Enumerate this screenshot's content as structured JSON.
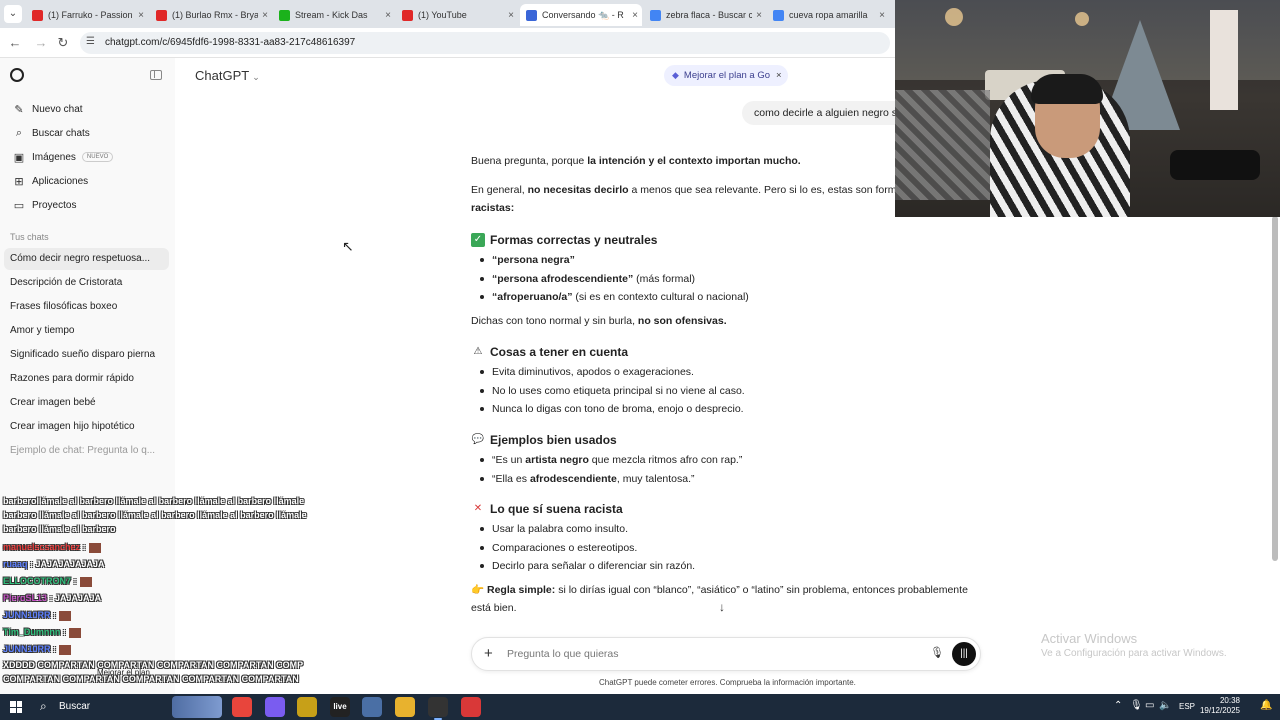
{
  "browser": {
    "tabs": [
      {
        "title": "(1) Farruko - Passion",
        "favicon": "youtube-icon",
        "color": "#e02828"
      },
      {
        "title": "(1) Burlao Rmx - Brya",
        "favicon": "youtube-icon",
        "color": "#e02828"
      },
      {
        "title": "Stream - Kick Das",
        "favicon": "kick-icon",
        "color": "#1bb21b"
      },
      {
        "title": "(1) YouTube",
        "favicon": "youtube-icon",
        "color": "#e02828"
      },
      {
        "title": "Conversando 🐀 - R",
        "favicon": "chatgpt-icon",
        "color": "#3a66d8"
      },
      {
        "title": "zebra flaca - Buscar c",
        "favicon": "google-icon",
        "color": "#4285f4"
      },
      {
        "title": "cueva ropa amarilla",
        "favicon": "google-icon",
        "color": "#4285f4"
      }
    ],
    "url": "chatgpt.com/c/6945fdf6-1998-8331-aa83-217c48616397"
  },
  "sidebar": {
    "nav": [
      {
        "label": "Nuevo chat",
        "icon": "new-chat-icon",
        "glyph": "✎"
      },
      {
        "label": "Buscar chats",
        "icon": "search-icon",
        "glyph": "⌕"
      },
      {
        "label": "Imágenes",
        "icon": "images-icon",
        "glyph": "▣",
        "badge": "NUEVO"
      },
      {
        "label": "Aplicaciones",
        "icon": "apps-icon",
        "glyph": "⊞"
      },
      {
        "label": "Proyectos",
        "icon": "folder-icon",
        "glyph": "▭"
      }
    ],
    "section_label": "Tus chats",
    "chats": [
      "Cómo decir negro respetuosa...",
      "Descripción de Cristorata",
      "Frases filosóficas boxeo",
      "Amor y tiempo",
      "Significado sueño disparo pierna",
      "Razones para dormir rápido",
      "Crear imagen bebé",
      "Crear imagen hijo hipotético",
      "Ejemplo de chat: Pregunta lo q..."
    ],
    "upsell": "Mejorar el plan"
  },
  "stream_chat": {
    "lines": [
      {
        "user": "",
        "text": "barberoIlámale al barbero llámale al barbero llámale al barbero llámale",
        "color": "#ffffff"
      },
      {
        "user": "",
        "text": "barbero llámale al barbero llámale al barbero llámale al barbero llámale",
        "color": "#ffffff"
      },
      {
        "user": "",
        "text": "barbero llámale al barbero",
        "color": "#ffffff"
      },
      {
        "user": "manuelscsanchez",
        "text": ":",
        "color": "#e83a3a"
      },
      {
        "user": "ruaaq",
        "text": ": JAJAJAJAJAJA",
        "color": "#5b7fff"
      },
      {
        "user": "ELLOCOTRON7",
        "text": ":",
        "color": "#2fc07c"
      },
      {
        "user": "PieroSL13",
        "text": ": JAJAJAJA",
        "color": "#c04ec0"
      },
      {
        "user": "JUNN10RR",
        "text": ":",
        "color": "#5b7fff"
      },
      {
        "user": "Tim_Dumnnn",
        "text": ":",
        "color": "#2fc07c"
      },
      {
        "user": "JUNN10RR",
        "text": ":",
        "color": "#5b7fff"
      },
      {
        "user": "XDDDD",
        "text": "COMPARTAN COMPARTAN COMPARTAN COMPARTAN COMP",
        "color": "#ffffff"
      },
      {
        "user": "",
        "text": "COMPARTAN COMPARTAN COMPARTAN COMPARTAN COMPARTAN",
        "color": "#ffffff"
      }
    ]
  },
  "main": {
    "model_label": "ChatGPT",
    "upgrade_label": "Mejorar el plan a Go",
    "user_message": "como decirle a alguien negro s",
    "answer": {
      "intro_prefix": "Buena pregunta, porque ",
      "intro_bold": "la intención y el contexto importan mucho.",
      "general_prefix": "En general, ",
      "general_bold": "no necesitas decirlo",
      "general_suffix": " a menos que sea relevante. Pero si lo es, estas son formas",
      "general_bold2": "racistas:",
      "sections": [
        {
          "heading": "Formas correctas y neutrales",
          "icon": "check-icon",
          "glyph": "✓",
          "bg": "#3aa757",
          "items": [
            {
              "bold": "“persona negra”",
              "rest": ""
            },
            {
              "bold": "“persona afrodescendiente”",
              "rest": " (más formal)"
            },
            {
              "bold": "“afroperuano/a”",
              "rest": " (si es en contexto cultural o nacional)"
            }
          ]
        },
        {
          "heading": "Cosas a tener en cuenta",
          "icon": "warning-icon",
          "glyph": "⚠",
          "bg": "#ffffff",
          "items": [
            {
              "bold": "",
              "rest": "Evita diminutivos, apodos o exageraciones."
            },
            {
              "bold": "",
              "rest": "No lo uses como etiqueta principal si no viene al caso."
            },
            {
              "bold": "",
              "rest": "Nunca lo digas con tono de broma, enojo o desprecio."
            }
          ]
        },
        {
          "heading": "Ejemplos bien usados",
          "icon": "speech-bubble-icon",
          "glyph": "💬",
          "bg": "#ffffff",
          "items": [
            {
              "bold": "",
              "rest": "“Es un ",
              "bold2": "artista negro",
              "rest2": " que mezcla ritmos afro con rap.”"
            },
            {
              "bold": "",
              "rest": "“Ella es ",
              "bold2": "afrodescendiente",
              "rest2": ", muy talentosa.”"
            }
          ]
        },
        {
          "heading": "Lo que sí suena racista",
          "icon": "cross-icon",
          "glyph": "✕",
          "bg": "#ffffff",
          "items": [
            {
              "bold": "",
              "rest": "Usar la palabra como insulto."
            },
            {
              "bold": "",
              "rest": "Comparaciones o estereotipos."
            },
            {
              "bold": "",
              "rest": "Decirlo para señalar o diferenciar sin razón."
            }
          ]
        }
      ],
      "neutral_prefix": "Dichas con tono normal y sin burla, ",
      "neutral_bold": "no son ofensivas.",
      "rule_bold": "Regla simple:",
      "rule_text": " si lo dirías igual con “blanco”, “asiático” o “latino” sin problema, entonces probablemente",
      "rule_text2": "está bien."
    },
    "composer_placeholder": "Pregunta lo que quieras",
    "disclaimer": "ChatGPT puede cometer errores. Comprueba la información importante."
  },
  "windows_watermark": {
    "title": "Activar Windows",
    "subtitle": "Ve a Configuración para activar Windows."
  },
  "taskbar": {
    "search_label": "Buscar",
    "apps": [
      {
        "name": "chrome-icon",
        "label": "",
        "color": "#e8453c"
      },
      {
        "name": "copilot-icon",
        "label": "",
        "color": "#7a5cf0"
      },
      {
        "name": "app-yellow-icon",
        "label": "",
        "color": "#c7a018"
      },
      {
        "name": "live-icon",
        "label": "live",
        "color": "#222222"
      },
      {
        "name": "notepad-icon",
        "label": "",
        "color": "#4a6fa5"
      },
      {
        "name": "files-icon",
        "label": "",
        "color": "#e8b22e"
      },
      {
        "name": "obs-icon",
        "label": "",
        "color": "#333333"
      },
      {
        "name": "app-red-icon",
        "label": "",
        "color": "#d93838"
      }
    ],
    "language": "ESP",
    "time": "20:38",
    "date": "19/12/2025"
  }
}
